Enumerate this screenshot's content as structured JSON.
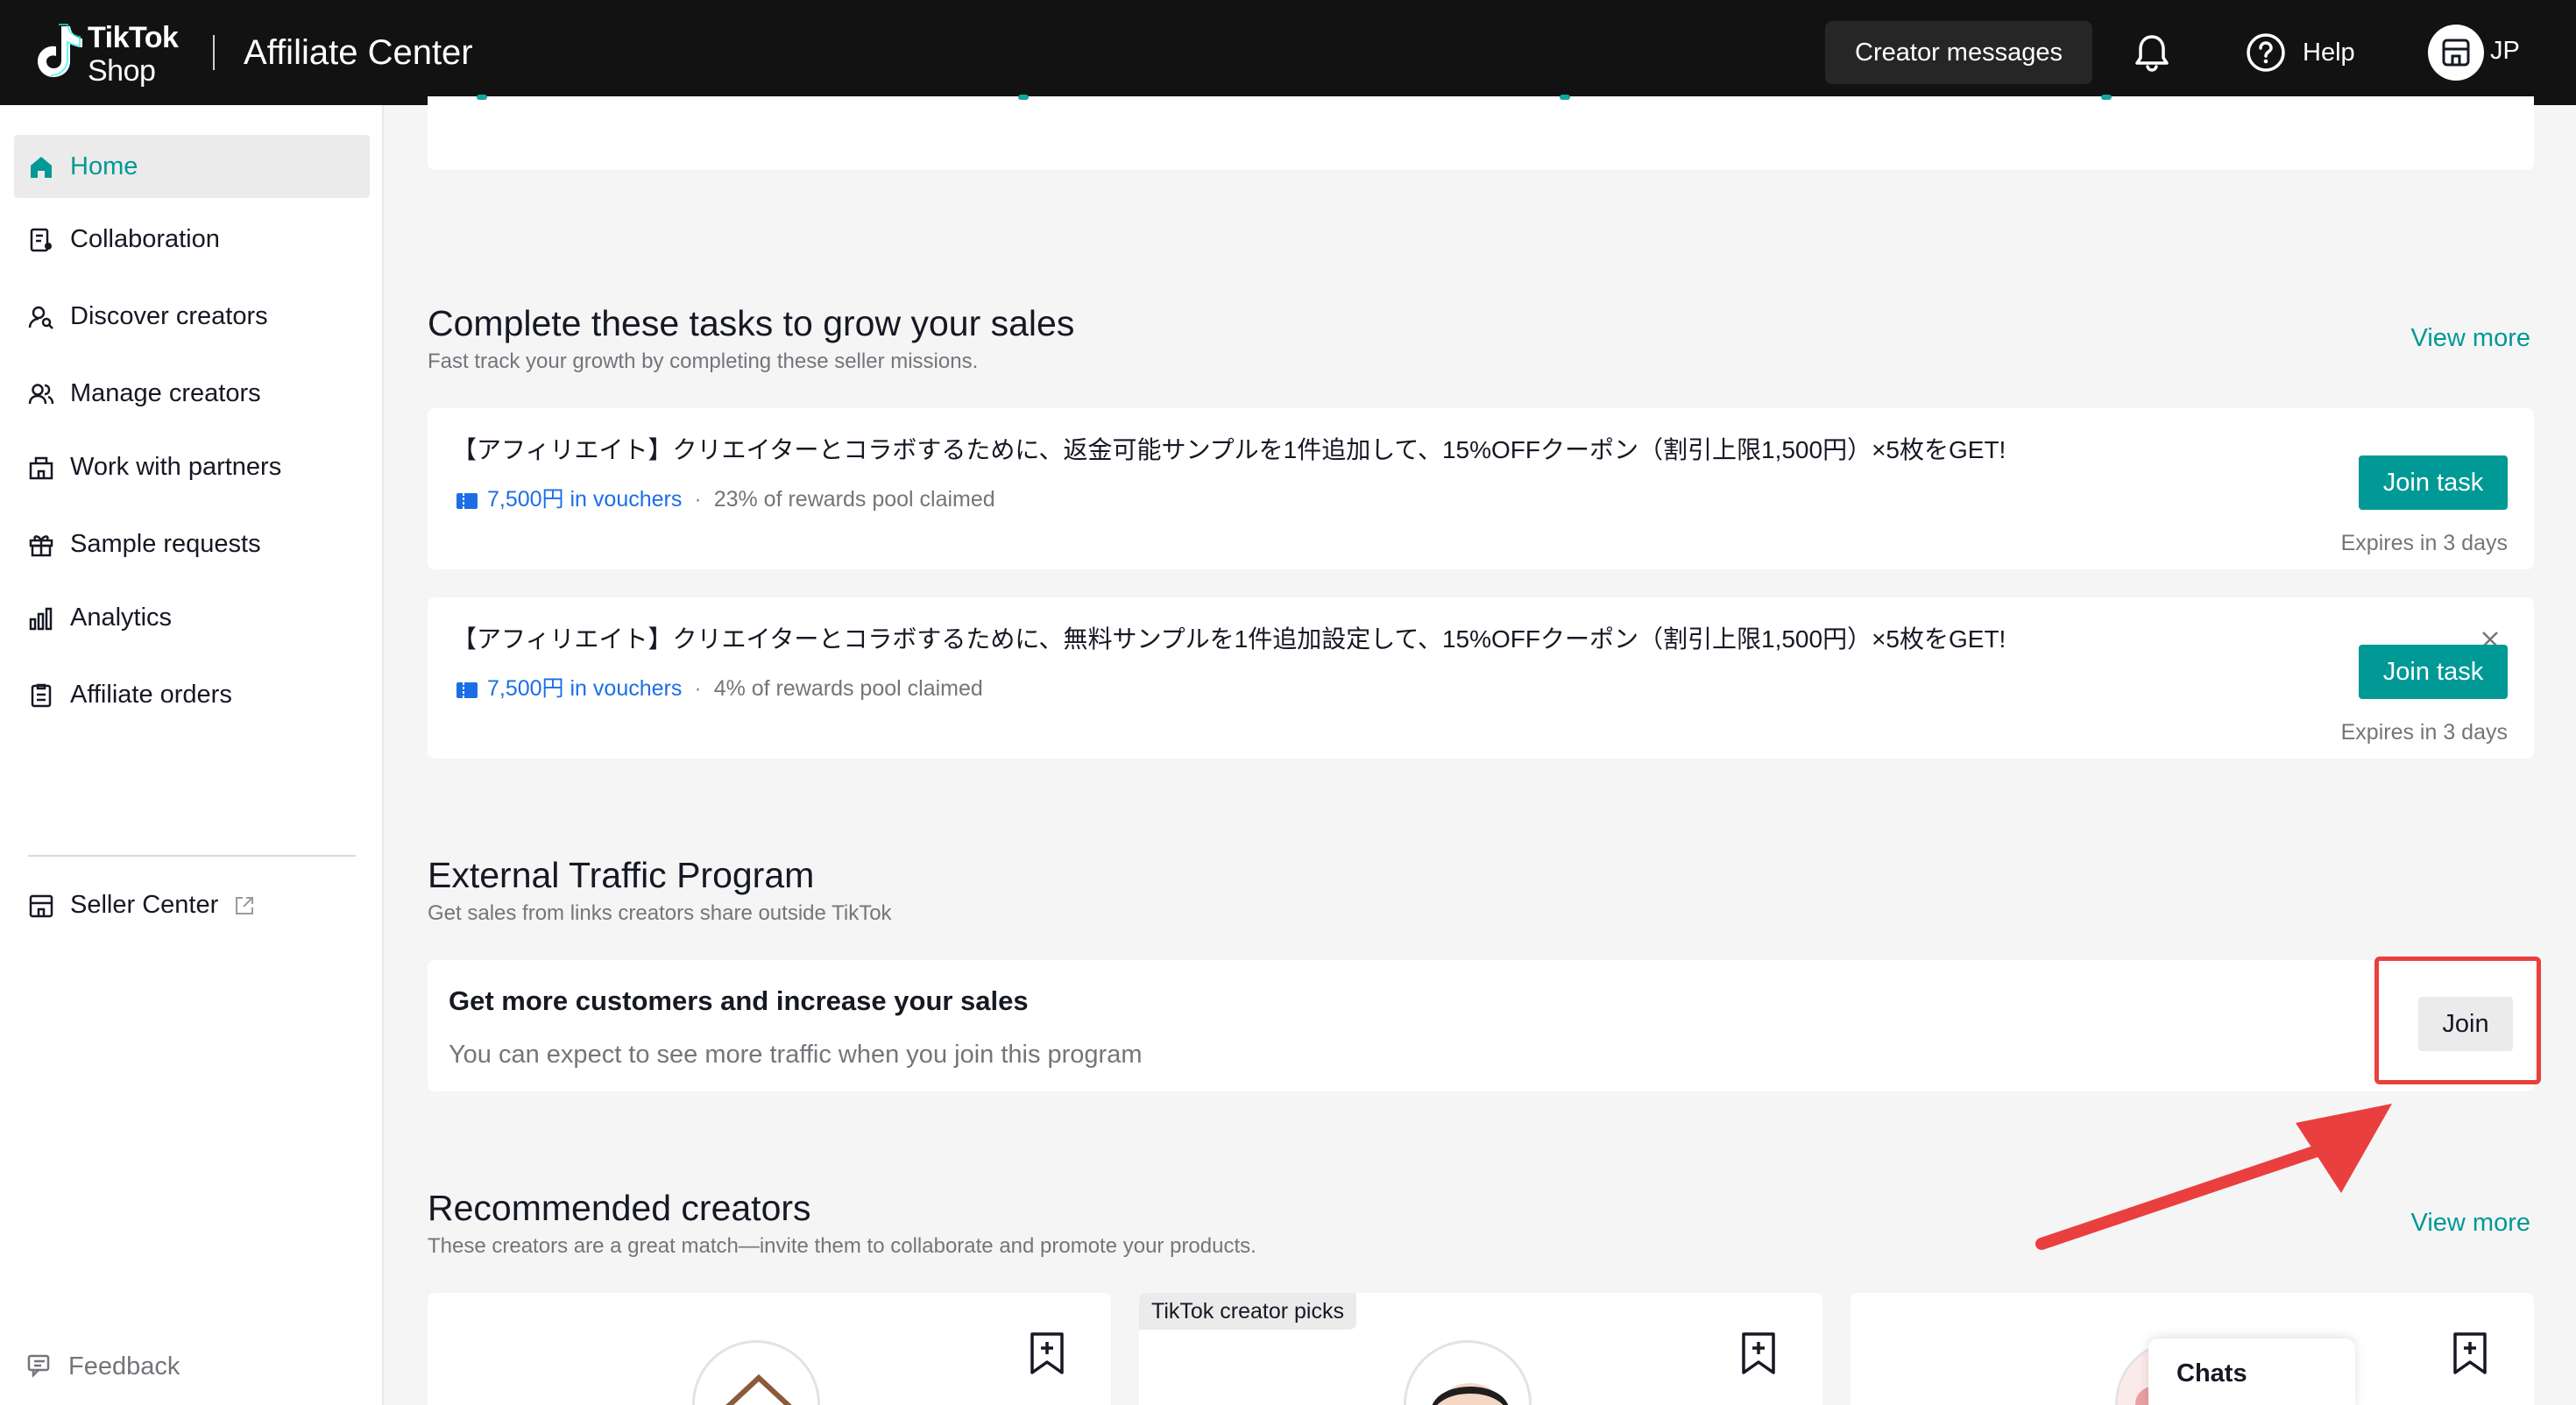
{
  "header": {
    "logo_line1": "TikTok",
    "logo_line2": "Shop",
    "app_title": "Affiliate Center",
    "creator_messages": "Creator messages",
    "help": "Help",
    "region": "JP"
  },
  "sidebar": {
    "items": [
      {
        "label": "Home",
        "icon": "home-icon",
        "active": true
      },
      {
        "label": "Collaboration",
        "icon": "collaboration-icon"
      },
      {
        "label": "Discover creators",
        "icon": "discover-creators-icon"
      },
      {
        "label": "Manage creators",
        "icon": "manage-creators-icon"
      },
      {
        "label": "Work with partners",
        "icon": "partners-icon"
      },
      {
        "label": "Sample requests",
        "icon": "gift-icon"
      },
      {
        "label": "Analytics",
        "icon": "analytics-icon"
      },
      {
        "label": "Affiliate orders",
        "icon": "orders-icon"
      }
    ],
    "seller_center": "Seller Center",
    "feedback": "Feedback"
  },
  "tasks_section": {
    "title": "Complete these tasks to grow your sales",
    "subtitle": "Fast track your growth by completing these seller missions.",
    "view_more": "View more",
    "tasks": [
      {
        "title": "【アフィリエイト】クリエイターとコラボするために、返金可能サンプルを1件追加して、15%OFFクーポン（割引上限1,500円）×5枚をGET!",
        "reward": "7,500円 in vouchers",
        "separator": "·",
        "pool": "23% of rewards pool claimed",
        "button": "Join task",
        "expires": "Expires in 3 days"
      },
      {
        "title": "【アフィリエイト】クリエイターとコラボするために、無料サンプルを1件追加設定して、15%OFFクーポン（割引上限1,500円）×5枚をGET!",
        "reward": "7,500円 in vouchers",
        "separator": "·",
        "pool": "4% of rewards pool claimed",
        "button": "Join task",
        "expires": "Expires in 3 days"
      }
    ]
  },
  "external_traffic": {
    "title": "External Traffic Program",
    "subtitle": "Get sales from links creators share outside TikTok",
    "card_title": "Get more customers and increase your sales",
    "card_sub": "You can expect to see more traffic when you join this program",
    "button": "Join"
  },
  "recommended": {
    "title": "Recommended creators",
    "subtitle": "These creators are a great match—invite them to collaborate and promote your products.",
    "view_more": "View more",
    "badge": "TikTok creator picks"
  },
  "chats": {
    "label": "Chats"
  },
  "colors": {
    "accent": "#009995",
    "voucher": "#1d6ee6",
    "highlight": "#ea3f3f",
    "topbar": "#121212"
  }
}
